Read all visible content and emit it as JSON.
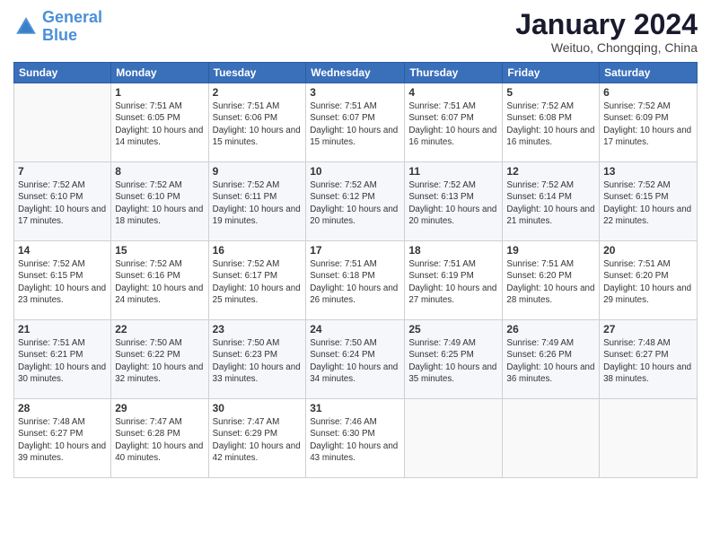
{
  "logo": {
    "line1": "General",
    "line2": "Blue"
  },
  "title": "January 2024",
  "subtitle": "Weituo, Chongqing, China",
  "days_header": [
    "Sunday",
    "Monday",
    "Tuesday",
    "Wednesday",
    "Thursday",
    "Friday",
    "Saturday"
  ],
  "weeks": [
    [
      {
        "day": "",
        "sunrise": "",
        "sunset": "",
        "daylight": ""
      },
      {
        "day": "1",
        "sunrise": "Sunrise: 7:51 AM",
        "sunset": "Sunset: 6:05 PM",
        "daylight": "Daylight: 10 hours and 14 minutes."
      },
      {
        "day": "2",
        "sunrise": "Sunrise: 7:51 AM",
        "sunset": "Sunset: 6:06 PM",
        "daylight": "Daylight: 10 hours and 15 minutes."
      },
      {
        "day": "3",
        "sunrise": "Sunrise: 7:51 AM",
        "sunset": "Sunset: 6:07 PM",
        "daylight": "Daylight: 10 hours and 15 minutes."
      },
      {
        "day": "4",
        "sunrise": "Sunrise: 7:51 AM",
        "sunset": "Sunset: 6:07 PM",
        "daylight": "Daylight: 10 hours and 16 minutes."
      },
      {
        "day": "5",
        "sunrise": "Sunrise: 7:52 AM",
        "sunset": "Sunset: 6:08 PM",
        "daylight": "Daylight: 10 hours and 16 minutes."
      },
      {
        "day": "6",
        "sunrise": "Sunrise: 7:52 AM",
        "sunset": "Sunset: 6:09 PM",
        "daylight": "Daylight: 10 hours and 17 minutes."
      }
    ],
    [
      {
        "day": "7",
        "sunrise": "Sunrise: 7:52 AM",
        "sunset": "Sunset: 6:10 PM",
        "daylight": "Daylight: 10 hours and 17 minutes."
      },
      {
        "day": "8",
        "sunrise": "Sunrise: 7:52 AM",
        "sunset": "Sunset: 6:10 PM",
        "daylight": "Daylight: 10 hours and 18 minutes."
      },
      {
        "day": "9",
        "sunrise": "Sunrise: 7:52 AM",
        "sunset": "Sunset: 6:11 PM",
        "daylight": "Daylight: 10 hours and 19 minutes."
      },
      {
        "day": "10",
        "sunrise": "Sunrise: 7:52 AM",
        "sunset": "Sunset: 6:12 PM",
        "daylight": "Daylight: 10 hours and 20 minutes."
      },
      {
        "day": "11",
        "sunrise": "Sunrise: 7:52 AM",
        "sunset": "Sunset: 6:13 PM",
        "daylight": "Daylight: 10 hours and 20 minutes."
      },
      {
        "day": "12",
        "sunrise": "Sunrise: 7:52 AM",
        "sunset": "Sunset: 6:14 PM",
        "daylight": "Daylight: 10 hours and 21 minutes."
      },
      {
        "day": "13",
        "sunrise": "Sunrise: 7:52 AM",
        "sunset": "Sunset: 6:15 PM",
        "daylight": "Daylight: 10 hours and 22 minutes."
      }
    ],
    [
      {
        "day": "14",
        "sunrise": "Sunrise: 7:52 AM",
        "sunset": "Sunset: 6:15 PM",
        "daylight": "Daylight: 10 hours and 23 minutes."
      },
      {
        "day": "15",
        "sunrise": "Sunrise: 7:52 AM",
        "sunset": "Sunset: 6:16 PM",
        "daylight": "Daylight: 10 hours and 24 minutes."
      },
      {
        "day": "16",
        "sunrise": "Sunrise: 7:52 AM",
        "sunset": "Sunset: 6:17 PM",
        "daylight": "Daylight: 10 hours and 25 minutes."
      },
      {
        "day": "17",
        "sunrise": "Sunrise: 7:51 AM",
        "sunset": "Sunset: 6:18 PM",
        "daylight": "Daylight: 10 hours and 26 minutes."
      },
      {
        "day": "18",
        "sunrise": "Sunrise: 7:51 AM",
        "sunset": "Sunset: 6:19 PM",
        "daylight": "Daylight: 10 hours and 27 minutes."
      },
      {
        "day": "19",
        "sunrise": "Sunrise: 7:51 AM",
        "sunset": "Sunset: 6:20 PM",
        "daylight": "Daylight: 10 hours and 28 minutes."
      },
      {
        "day": "20",
        "sunrise": "Sunrise: 7:51 AM",
        "sunset": "Sunset: 6:20 PM",
        "daylight": "Daylight: 10 hours and 29 minutes."
      }
    ],
    [
      {
        "day": "21",
        "sunrise": "Sunrise: 7:51 AM",
        "sunset": "Sunset: 6:21 PM",
        "daylight": "Daylight: 10 hours and 30 minutes."
      },
      {
        "day": "22",
        "sunrise": "Sunrise: 7:50 AM",
        "sunset": "Sunset: 6:22 PM",
        "daylight": "Daylight: 10 hours and 32 minutes."
      },
      {
        "day": "23",
        "sunrise": "Sunrise: 7:50 AM",
        "sunset": "Sunset: 6:23 PM",
        "daylight": "Daylight: 10 hours and 33 minutes."
      },
      {
        "day": "24",
        "sunrise": "Sunrise: 7:50 AM",
        "sunset": "Sunset: 6:24 PM",
        "daylight": "Daylight: 10 hours and 34 minutes."
      },
      {
        "day": "25",
        "sunrise": "Sunrise: 7:49 AM",
        "sunset": "Sunset: 6:25 PM",
        "daylight": "Daylight: 10 hours and 35 minutes."
      },
      {
        "day": "26",
        "sunrise": "Sunrise: 7:49 AM",
        "sunset": "Sunset: 6:26 PM",
        "daylight": "Daylight: 10 hours and 36 minutes."
      },
      {
        "day": "27",
        "sunrise": "Sunrise: 7:48 AM",
        "sunset": "Sunset: 6:27 PM",
        "daylight": "Daylight: 10 hours and 38 minutes."
      }
    ],
    [
      {
        "day": "28",
        "sunrise": "Sunrise: 7:48 AM",
        "sunset": "Sunset: 6:27 PM",
        "daylight": "Daylight: 10 hours and 39 minutes."
      },
      {
        "day": "29",
        "sunrise": "Sunrise: 7:47 AM",
        "sunset": "Sunset: 6:28 PM",
        "daylight": "Daylight: 10 hours and 40 minutes."
      },
      {
        "day": "30",
        "sunrise": "Sunrise: 7:47 AM",
        "sunset": "Sunset: 6:29 PM",
        "daylight": "Daylight: 10 hours and 42 minutes."
      },
      {
        "day": "31",
        "sunrise": "Sunrise: 7:46 AM",
        "sunset": "Sunset: 6:30 PM",
        "daylight": "Daylight: 10 hours and 43 minutes."
      },
      {
        "day": "",
        "sunrise": "",
        "sunset": "",
        "daylight": ""
      },
      {
        "day": "",
        "sunrise": "",
        "sunset": "",
        "daylight": ""
      },
      {
        "day": "",
        "sunrise": "",
        "sunset": "",
        "daylight": ""
      }
    ]
  ]
}
